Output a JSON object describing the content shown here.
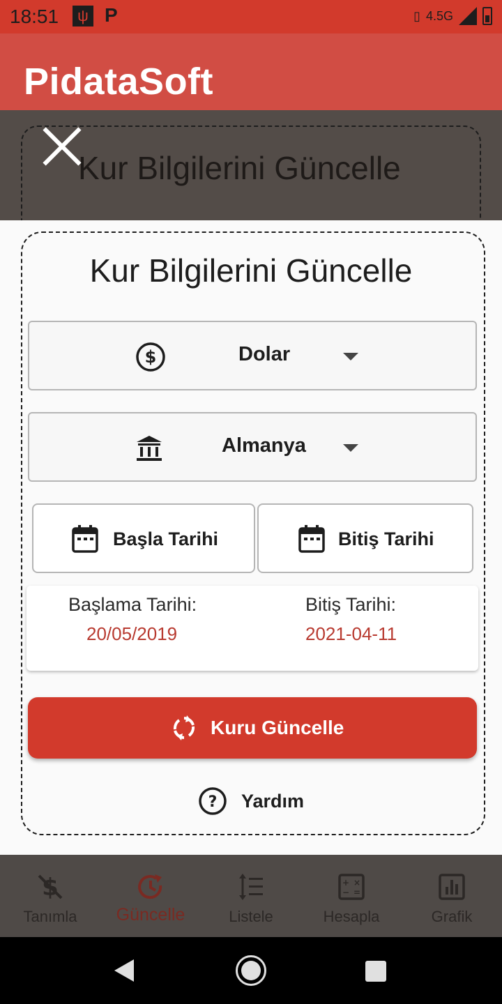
{
  "status_bar": {
    "time": "18:51",
    "network": "4.5G"
  },
  "app_bar": {
    "title": "PidataSoft"
  },
  "background": {
    "title": "Kur Bilgilerini Güncelle"
  },
  "sheet": {
    "title": "Kur Bilgilerini Güncelle",
    "currency": {
      "value": "Dolar",
      "icon": "dollar-circle-icon"
    },
    "country": {
      "value": "Almanya",
      "icon": "bank-icon"
    },
    "start_button": "Başla Tarihi",
    "end_button": "Bitiş Tarihi",
    "start_label": "Başlama Tarihi:",
    "start_value": "20/05/2019",
    "end_label": "Bitiş Tarihi:",
    "end_value": "2021-04-11",
    "update_button": "Kuru Güncelle",
    "help": "Yardım"
  },
  "bottom_nav": {
    "items": [
      {
        "label": "Tanımla",
        "icon": "money-off-icon"
      },
      {
        "label": "Güncelle",
        "icon": "update-icon",
        "active": true
      },
      {
        "label": "Listele",
        "icon": "list-icon"
      },
      {
        "label": "Hesapla",
        "icon": "calculator-icon"
      },
      {
        "label": "Grafik",
        "icon": "bar-chart-icon"
      }
    ]
  },
  "colors": {
    "primary": "#d23a2c",
    "app_bar": "#d14d44",
    "accent_text": "#b83a30"
  }
}
